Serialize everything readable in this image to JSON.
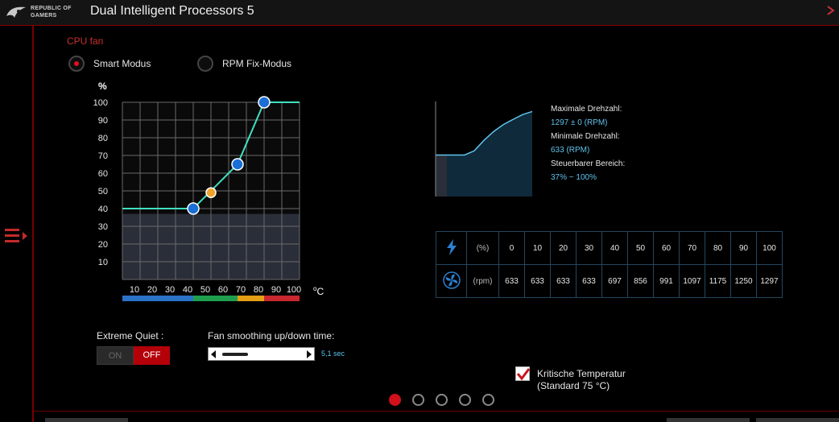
{
  "app": {
    "title": "Dual Intelligent Processors 5",
    "logo_line1": "REPUBLIC OF",
    "logo_line2": "GAMERS",
    "close_glyph": "∕"
  },
  "section": {
    "label": "CPU fan"
  },
  "mode": {
    "options": [
      {
        "label": "Smart Modus",
        "selected": true
      },
      {
        "label": "RPM Fix-Modus",
        "selected": false
      }
    ]
  },
  "chart_data": {
    "type": "line",
    "title": "",
    "ylabel": "%",
    "xlabel": "°C",
    "x_ticks": [
      "10",
      "20",
      "30",
      "40",
      "50",
      "60",
      "70",
      "80",
      "90",
      "100"
    ],
    "y_ticks": [
      "100",
      "90",
      "80",
      "70",
      "60",
      "50",
      "40",
      "30",
      "20",
      "10"
    ],
    "xlim": [
      0,
      100
    ],
    "ylim": [
      0,
      100
    ],
    "grid": true,
    "series": [
      {
        "x": [
          0,
          40,
          65,
          80,
          100
        ],
        "y": [
          40,
          40,
          65,
          100,
          100
        ]
      }
    ],
    "control_points": [
      {
        "x": 40,
        "y": 40,
        "color": "#1a6fd6"
      },
      {
        "x": 65,
        "y": 65,
        "color": "#1a6fd6"
      },
      {
        "x": 80,
        "y": 100,
        "color": "#1a6fd6"
      }
    ],
    "midpoint": {
      "x": 50,
      "y": 49,
      "color": "#f0a22a"
    },
    "min_floor": 37,
    "temp_zones": [
      {
        "from": 0,
        "to": 40,
        "color": "#2b73c7"
      },
      {
        "from": 40,
        "to": 65,
        "color": "#1f9f4e"
      },
      {
        "from": 65,
        "to": 80,
        "color": "#e3a014"
      },
      {
        "from": 80,
        "to": 100,
        "color": "#c8282e"
      }
    ]
  },
  "chart_units": {
    "y": "%",
    "x_symbol": "o",
    "x": "C"
  },
  "fan_info": {
    "max_label": "Maximale Drehzahl:",
    "max_value": "1297 ± 0 (RPM)",
    "min_label": "Minimale Drehzahl:",
    "min_value": "633 (RPM)",
    "range_label": "Steuerbarer Bereich:",
    "range_value": "37% ~ 100%"
  },
  "rpm_curve": {
    "percent": [
      0,
      10,
      20,
      30,
      40,
      50,
      60,
      70,
      80,
      90,
      100
    ],
    "rpm": [
      633,
      633,
      633,
      633,
      697,
      856,
      991,
      1097,
      1175,
      1250,
      1297
    ]
  },
  "speed_table": {
    "power_unit": "(%)",
    "rpm_unit": "(rpm)",
    "percent": [
      "0",
      "10",
      "20",
      "30",
      "40",
      "50",
      "60",
      "70",
      "80",
      "90",
      "100"
    ],
    "rpm": [
      "633",
      "633",
      "633",
      "633",
      "697",
      "856",
      "991",
      "1097",
      "1175",
      "1250",
      "1297"
    ]
  },
  "extreme_quiet": {
    "label": "Extreme Quiet :",
    "on": "ON",
    "off": "OFF",
    "state": "off"
  },
  "smoothing": {
    "label": "Fan smoothing up/down time:",
    "value": "5,1 sec"
  },
  "critical_temp": {
    "line1": "Kritische Temperatur",
    "line2": "(Standard 75 °C)",
    "checked": true
  },
  "pager": {
    "count": 5,
    "active": 0
  },
  "colors": {
    "accent": "#c42a2a",
    "curve": "#40e0c0",
    "info": "#5fc3ec",
    "grid": "#6a6a6a"
  }
}
